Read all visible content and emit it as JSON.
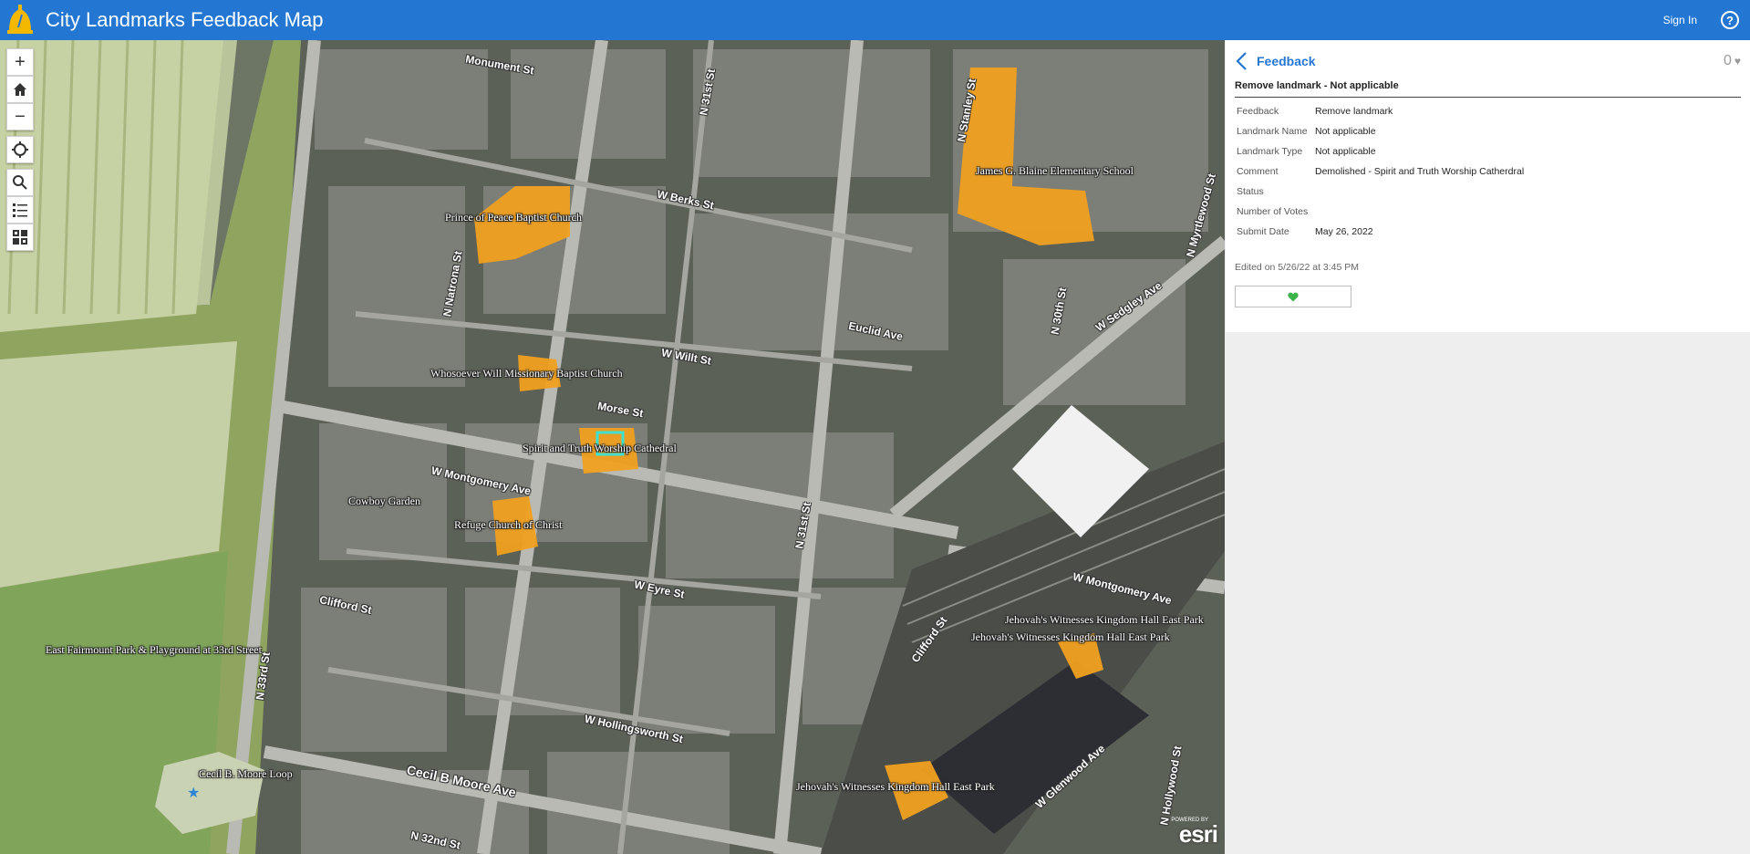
{
  "header": {
    "title": "City Landmarks Feedback Map",
    "sign_in": "Sign In",
    "help": "?"
  },
  "map": {
    "landmarks": [
      "James G. Blaine Elementary School",
      "Prince of Peace Baptist Church",
      "Whosoever Will Missionary Baptist Church",
      "Spirit and Truth Worship Cathedral",
      "Cowboy Garden",
      "Refuge Church of Christ",
      "Jehovah's Witnesses Kingdom Hall East Park",
      "Jehovah's Witnesses Kingdom Hall East Park",
      "Jehovah's Witnesses Kingdom Hall East Park",
      "East Fairmount Park & Playground at 33rd Street",
      "Cecil B. Moore Loop"
    ],
    "streets": [
      "Monument St",
      "W Berks St",
      "N Stanley St",
      "N 31st St",
      "N 30th St",
      "N Myrtlewood St",
      "N Natrona St",
      "Euclid Ave",
      "W Sedgley Ave",
      "W Willt St",
      "Morse St",
      "W Montgomery Ave",
      "W Montgomery Ave",
      "N 31st St",
      "W Eyre St",
      "Clifford St",
      "Clifford St",
      "N 33rd St",
      "W Hollingsworth St",
      "Cecil B Moore Ave",
      "W Glenwood Ave",
      "N Hollywood St",
      "N 32nd St"
    ],
    "attribution": {
      "powered": "POWERED BY",
      "logo": "esri"
    }
  },
  "controls": {
    "zoom_in": "+",
    "zoom_out": "−"
  },
  "panel": {
    "title": "Feedback",
    "vote_count": "0",
    "feature_title": "Remove landmark - Not applicable",
    "attributes": [
      {
        "key": "Feedback",
        "value": "Remove landmark"
      },
      {
        "key": "Landmark Name",
        "value": "Not applicable"
      },
      {
        "key": "Landmark Type",
        "value": "Not applicable"
      },
      {
        "key": "Comment",
        "value": "Demolished - Spirit and Truth Worship Catherdral"
      },
      {
        "key": "Status",
        "value": ""
      },
      {
        "key": "Number of Votes",
        "value": ""
      },
      {
        "key": "Submit Date",
        "value": "May 26, 2022"
      }
    ],
    "edited": "Edited on 5/26/22 at 3:45 PM"
  },
  "colors": {
    "header": "#2476d3",
    "landmark_fill": "#f0a020",
    "selected_outline": "#3ee0d0",
    "vote_heart": "#3cb44b"
  }
}
